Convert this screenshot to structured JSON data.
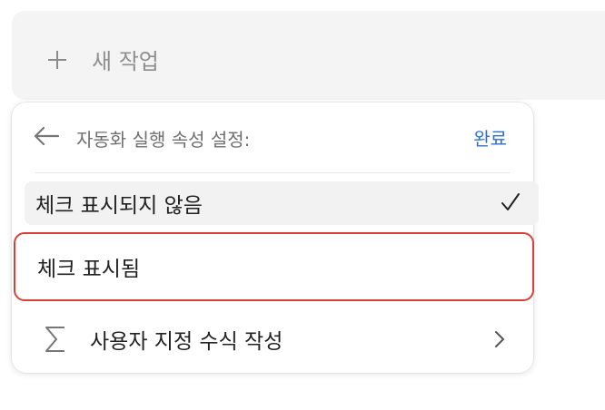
{
  "new_task": {
    "label": "새 작업",
    "icon": "plus-icon"
  },
  "menu": {
    "header": {
      "title": "자동화 실행 속성 설정:",
      "back_icon": "arrow-left-icon",
      "done_label": "완료"
    },
    "options": [
      {
        "label": "체크 표시되지 않음",
        "selected": true,
        "icon": "checkmark-icon"
      },
      {
        "label": "체크 표시됨",
        "highlighted": true
      },
      {
        "label": "사용자 지정 수식 작성",
        "icon": "sigma-icon",
        "trailing_icon": "chevron-right-icon"
      }
    ]
  },
  "colors": {
    "accent": "#2f6fd3",
    "highlight_border": "#d84138",
    "bar_background": "#f4f4f4"
  }
}
